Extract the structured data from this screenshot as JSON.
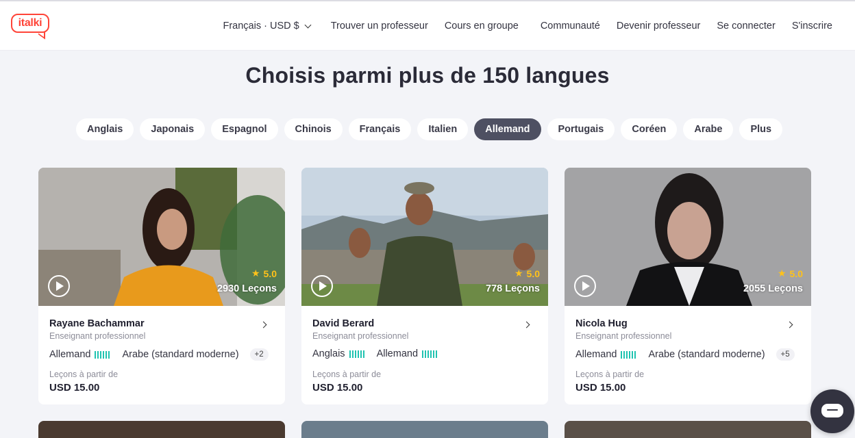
{
  "header": {
    "logo": "italki",
    "locale_currency": "Français · USD $",
    "nav": [
      "Trouver un professeur",
      "Cours en groupe",
      "Communauté",
      "Devenir professeur",
      "Se connecter",
      "S'inscrire"
    ]
  },
  "headline": "Choisis parmi plus de 150 langues",
  "language_chips": [
    "Anglais",
    "Japonais",
    "Espagnol",
    "Chinois",
    "Français",
    "Italien",
    "Allemand",
    "Portugais",
    "Coréen",
    "Arabe",
    "Plus"
  ],
  "selected_language": "Allemand",
  "teachers": [
    {
      "name": "Rayane Bachammar",
      "role": "Enseignant professionnel",
      "rating": "5.0",
      "lessons": "2930 Leçons",
      "languages": [
        "Allemand",
        "Arabe (standard moderne)"
      ],
      "more": "+2",
      "price_label": "Leçons à partir de",
      "price": "USD 15.00"
    },
    {
      "name": "David Berard",
      "role": "Enseignant professionnel",
      "rating": "5.0",
      "lessons": "778 Leçons",
      "languages": [
        "Anglais",
        "Allemand"
      ],
      "more": "",
      "price_label": "Leçons à partir de",
      "price": "USD 15.00"
    },
    {
      "name": "Nicola Hug",
      "role": "Enseignant professionnel",
      "rating": "5.0",
      "lessons": "2055 Leçons",
      "languages": [
        "Allemand",
        "Arabe (standard moderne)"
      ],
      "more": "+5",
      "price_label": "Leçons à partir de",
      "price": "USD 15.00"
    }
  ],
  "colors": {
    "brand": "#ff4438",
    "active_chip": "#4e5062",
    "rating_star": "#ffc21a",
    "proficiency_bars": "#1fc3b0",
    "chat_button": "#333340"
  }
}
